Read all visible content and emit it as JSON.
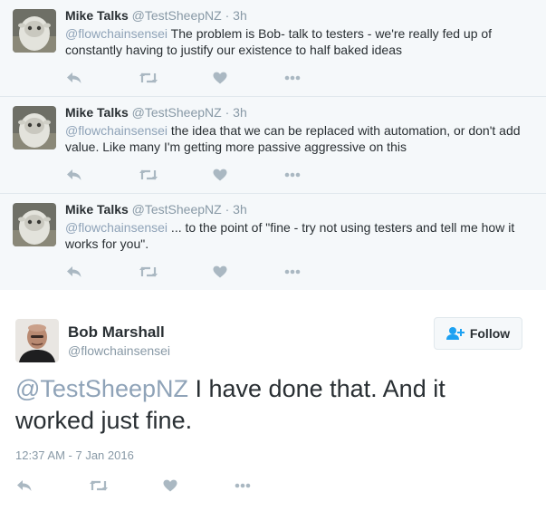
{
  "replies": [
    {
      "name": "Mike Talks",
      "handle": "@TestSheepNZ",
      "dot": "·",
      "time": "3h",
      "mention": "@flowchainsensei",
      "text": " The problem is Bob- talk to testers - we're really fed up of constantly having to justify our existence to half baked ideas"
    },
    {
      "name": "Mike Talks",
      "handle": "@TestSheepNZ",
      "dot": "·",
      "time": "3h",
      "mention": "@flowchainsensei",
      "text": " the idea that we can be replaced with automation, or don't add value. Like many I'm getting more passive aggressive on this"
    },
    {
      "name": "Mike Talks",
      "handle": "@TestSheepNZ",
      "dot": "·",
      "time": "3h",
      "mention": "@flowchainsensei",
      "text": " ... to the point of \"fine - try not using testers and tell me how it works for you\"."
    }
  ],
  "main": {
    "name": "Bob Marshall",
    "handle": "@flowchainsensei",
    "follow_label": "Follow",
    "mention": "@TestSheepNZ",
    "text": " I have done that. And it worked just fine.",
    "timestamp": "12:37 AM - 7 Jan 2016"
  },
  "icons": {
    "reply": "reply-icon",
    "retweet": "retweet-icon",
    "like": "heart-icon",
    "more": "more-icon",
    "follow": "add-user-icon"
  },
  "colors": {
    "reply_background": "#f5f8fa",
    "mention": "#8fa3b8",
    "action_icon": "#aab8c2",
    "follow_icon": "#1da1f2"
  }
}
